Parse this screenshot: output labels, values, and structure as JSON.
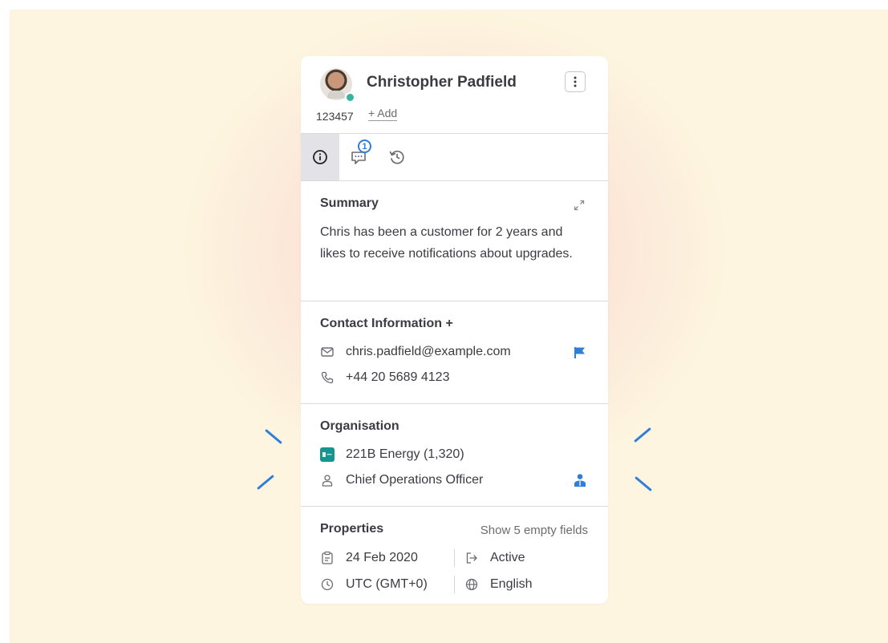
{
  "contact": {
    "name": "Christopher Padfield",
    "id": "123457",
    "add_label": "+ Add",
    "online": true
  },
  "tabs": [
    {
      "name": "info",
      "icon": "info-icon",
      "active": true
    },
    {
      "name": "conversations",
      "icon": "chat-icon",
      "badge": "1"
    },
    {
      "name": "history",
      "icon": "history-icon"
    }
  ],
  "summary": {
    "title": "Summary",
    "text": "Chris has been a customer for 2 years and likes to receive notifications about upgrades."
  },
  "contact_info": {
    "title": "Contact Information +",
    "email": "chris.padfield@example.com",
    "phone": "+44 20 5689 4123"
  },
  "organisation": {
    "title": "Organisation",
    "company": "221B Energy (1,320)",
    "role": "Chief Operations Officer"
  },
  "properties": {
    "title": "Properties",
    "show_empty": "Show 5 empty fields",
    "date": "24 Feb 2020",
    "status": "Active",
    "timezone": "UTC (GMT+0)",
    "language": "English"
  },
  "colors": {
    "accent": "#2f7fd8",
    "online": "#35b39c",
    "company_logo": "#14968f"
  }
}
